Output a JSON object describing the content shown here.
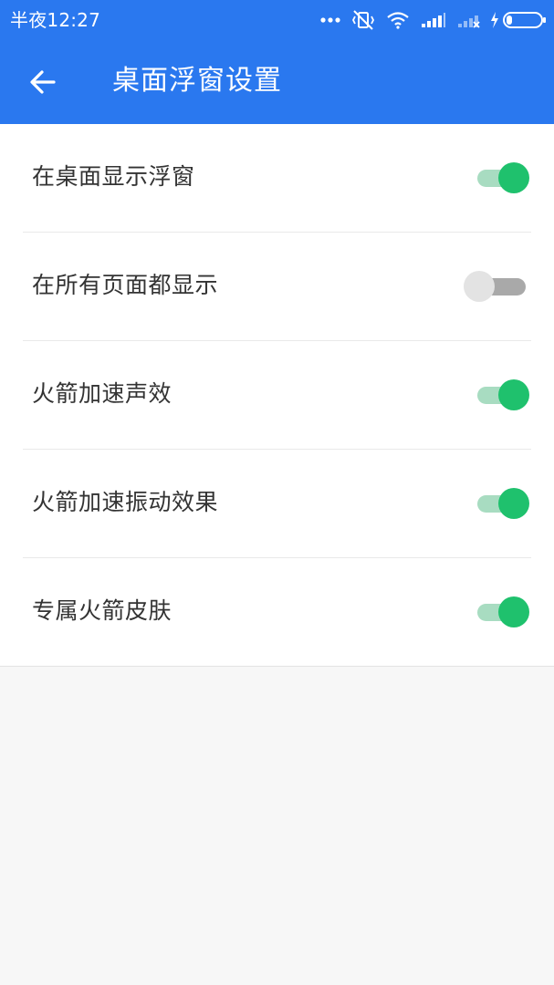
{
  "status_bar": {
    "time": "半夜12:27",
    "icons": [
      "more-dots-icon",
      "vibrate-off-icon",
      "wifi-icon",
      "signal-icon",
      "signal-no-sim-icon",
      "charging-icon",
      "battery-icon"
    ]
  },
  "header": {
    "back_icon": "arrow-left-icon",
    "title": "桌面浮窗设置"
  },
  "settings": [
    {
      "label": "在桌面显示浮窗",
      "enabled": true
    },
    {
      "label": "在所有页面都显示",
      "enabled": false
    },
    {
      "label": "火箭加速声效",
      "enabled": true
    },
    {
      "label": "火箭加速振动效果",
      "enabled": true
    },
    {
      "label": "专属火箭皮肤",
      "enabled": true
    }
  ],
  "colors": {
    "primary": "#2a78ef",
    "toggle_on_thumb": "#1fc16d",
    "toggle_on_track": "#a8dcc1",
    "toggle_off_thumb": "#e3e3e3",
    "toggle_off_track": "#a9a9a9",
    "background": "#f7f7f7"
  }
}
